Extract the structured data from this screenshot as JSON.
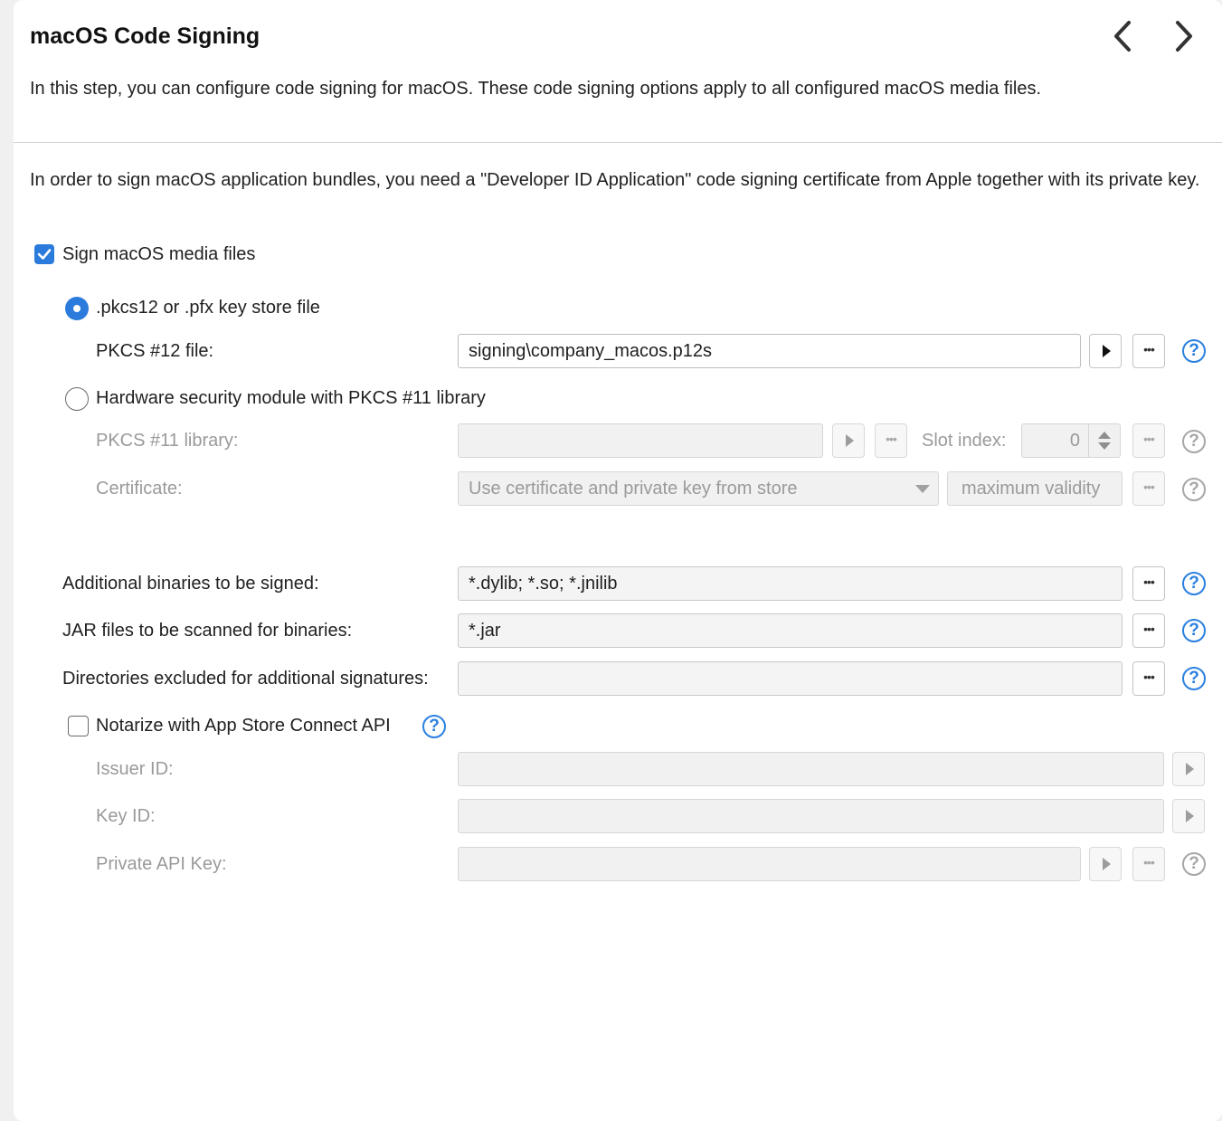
{
  "header": {
    "title": "macOS Code Signing",
    "description": "In this step, you can configure code signing for macOS. These code signing options apply to all configured macOS media files."
  },
  "intro": "In order to sign macOS application bundles, you need a \"Developer ID Application\" code signing certificate from Apple together with its private key.",
  "sign_checkbox": {
    "label": "Sign macOS media files",
    "checked": true
  },
  "pkcs12": {
    "radio_label": ".pkcs12 or .pfx key store file",
    "selected": true,
    "file_label": "PKCS #12 file:",
    "file_value": "signing\\company_macos.p12s"
  },
  "hsm": {
    "radio_label": "Hardware security module with PKCS #11 library",
    "selected": false,
    "library_label": "PKCS #11 library:",
    "library_value": "",
    "slot_label": "Slot index:",
    "slot_value": "0",
    "certificate_label": "Certificate:",
    "certificate_value": "Use certificate and private key from store",
    "validity_button": "maximum validity"
  },
  "additional_binaries": {
    "label": "Additional binaries to be signed:",
    "value": "*.dylib; *.so; *.jnilib"
  },
  "jar_files": {
    "label": "JAR files to be scanned for binaries:",
    "value": "*.jar"
  },
  "excluded_dirs": {
    "label": "Directories excluded for additional signatures:",
    "value": ""
  },
  "notarize": {
    "label": "Notarize with App Store Connect API",
    "checked": false,
    "issuer_label": "Issuer ID:",
    "issuer_value": "",
    "key_id_label": "Key ID:",
    "key_id_value": "",
    "private_key_label": "Private API Key:",
    "private_key_value": ""
  },
  "icons": {
    "back": "chevron-left-icon",
    "forward": "chevron-right-icon",
    "help": "question-icon",
    "browse": "ellipsis-icon",
    "run": "play-icon"
  },
  "colors": {
    "accent": "#2a7bdc",
    "help": "#2a80e0",
    "disabled": "#9a9a9a"
  }
}
